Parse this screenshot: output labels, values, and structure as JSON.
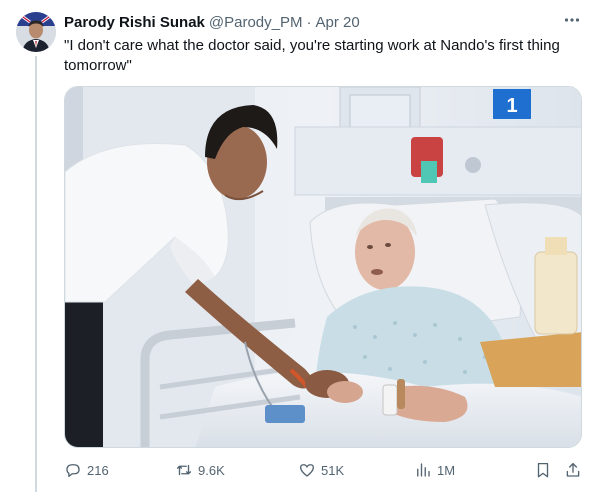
{
  "tweet": {
    "display_name": "Parody Rishi Sunak",
    "handle": "@Parody_PM",
    "separator": "·",
    "timestamp": "Apr 20",
    "text": "\"I don't care what the doctor said, you're starting work at Nando's first thing tomorrow\"",
    "more_icon": "more-horizontal-icon",
    "bed_number": "1"
  },
  "actions": {
    "replies": "216",
    "reposts": "9.6K",
    "likes": "51K",
    "views": "1M"
  },
  "icons": {
    "reply": "reply-icon",
    "repost": "repost-icon",
    "like": "heart-icon",
    "views": "analytics-icon",
    "bookmark": "bookmark-icon",
    "share": "share-icon"
  },
  "colors": {
    "text_primary": "#0f1419",
    "text_secondary": "#536471",
    "border": "#cfd9de"
  }
}
